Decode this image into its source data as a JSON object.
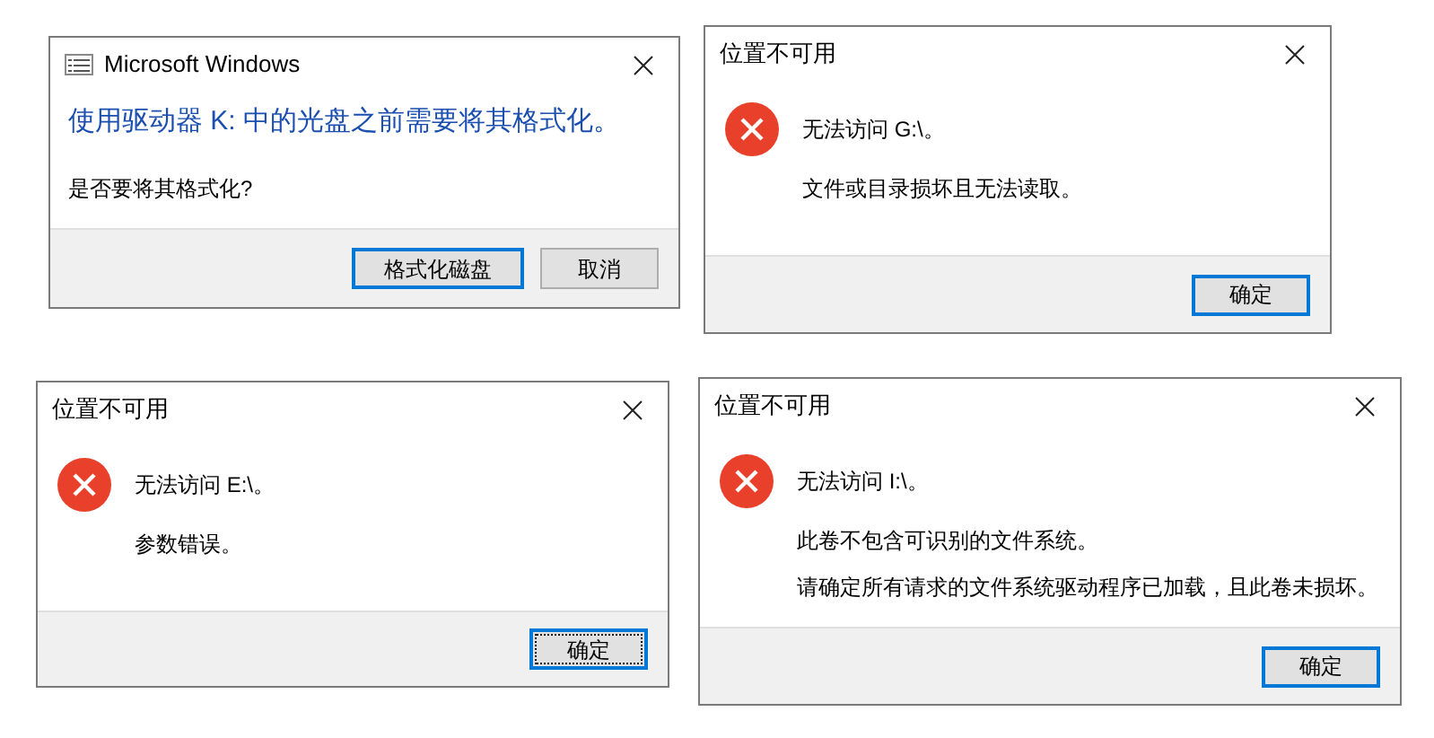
{
  "dialogs": [
    {
      "kind": "instruction",
      "title": "Microsoft Windows",
      "heading": "使用驱动器 K: 中的光盘之前需要将其格式化。",
      "messages": [
        "是否要将其格式化?"
      ],
      "buttons": [
        {
          "label": "格式化磁盘",
          "selected": true,
          "focused": false
        },
        {
          "label": "取消",
          "selected": false,
          "focused": false
        }
      ]
    },
    {
      "kind": "error",
      "title": "位置不可用",
      "heading": "无法访问 G:\\。",
      "messages": [
        "文件或目录损坏且无法读取。"
      ],
      "buttons": [
        {
          "label": "确定",
          "selected": true,
          "focused": false
        }
      ]
    },
    {
      "kind": "error",
      "title": "位置不可用",
      "heading": "无法访问 E:\\。",
      "messages": [
        "参数错误。"
      ],
      "buttons": [
        {
          "label": "确定",
          "selected": true,
          "focused": true
        }
      ]
    },
    {
      "kind": "error",
      "title": "位置不可用",
      "heading": "无法访问 I:\\。",
      "messages": [
        "此卷不包含可识别的文件系统。",
        "请确定所有请求的文件系统驱动程序已加载，且此卷未损坏。"
      ],
      "buttons": [
        {
          "label": "确定",
          "selected": true,
          "focused": false
        }
      ]
    }
  ]
}
